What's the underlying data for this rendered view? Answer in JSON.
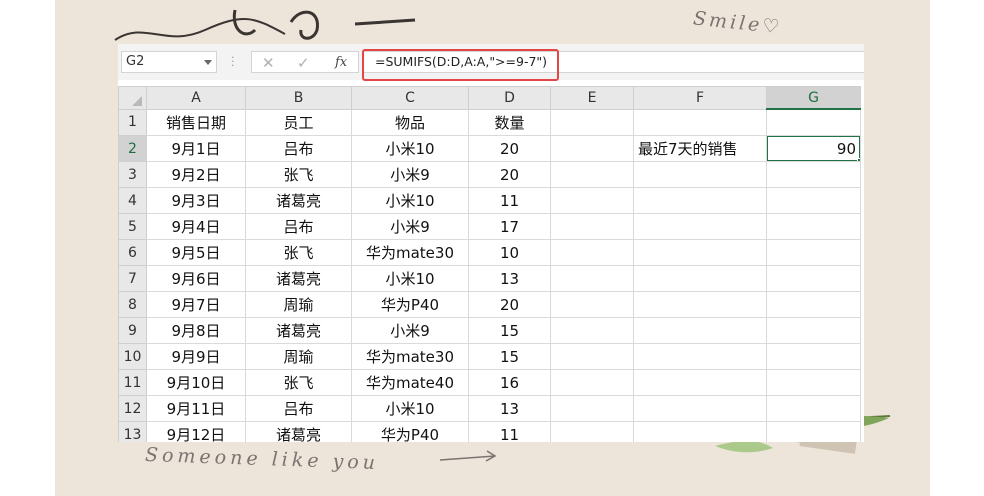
{
  "decor": {
    "smile_text": "Smile♡",
    "bottom_text": "Someone like you"
  },
  "formula_bar": {
    "name_box": "G2",
    "cancel_icon": "✕",
    "enter_icon": "✓",
    "fx_label": "fx",
    "formula": "=SUMIFS(D:D,A:A,\">=9-7\")"
  },
  "columns": [
    "A",
    "B",
    "C",
    "D",
    "E",
    "F",
    "G"
  ],
  "rows": [
    {
      "num": "1",
      "a": "销售日期",
      "b": "员工",
      "c": "物品",
      "d": "数量",
      "e": "",
      "f": "",
      "g": ""
    },
    {
      "num": "2",
      "a": "9月1日",
      "b": "吕布",
      "c": "小米10",
      "d": "20",
      "e": "",
      "f": "最近7天的销售",
      "g": "90"
    },
    {
      "num": "3",
      "a": "9月2日",
      "b": "张飞",
      "c": "小米9",
      "d": "20",
      "e": "",
      "f": "",
      "g": ""
    },
    {
      "num": "4",
      "a": "9月3日",
      "b": "诸葛亮",
      "c": "小米10",
      "d": "11",
      "e": "",
      "f": "",
      "g": ""
    },
    {
      "num": "5",
      "a": "9月4日",
      "b": "吕布",
      "c": "小米9",
      "d": "17",
      "e": "",
      "f": "",
      "g": ""
    },
    {
      "num": "6",
      "a": "9月5日",
      "b": "张飞",
      "c": "华为mate30",
      "d": "10",
      "e": "",
      "f": "",
      "g": ""
    },
    {
      "num": "7",
      "a": "9月6日",
      "b": "诸葛亮",
      "c": "小米10",
      "d": "13",
      "e": "",
      "f": "",
      "g": ""
    },
    {
      "num": "8",
      "a": "9月7日",
      "b": "周瑜",
      "c": "华为P40",
      "d": "20",
      "e": "",
      "f": "",
      "g": ""
    },
    {
      "num": "9",
      "a": "9月8日",
      "b": "诸葛亮",
      "c": "小米9",
      "d": "15",
      "e": "",
      "f": "",
      "g": ""
    },
    {
      "num": "10",
      "a": "9月9日",
      "b": "周瑜",
      "c": "华为mate30",
      "d": "15",
      "e": "",
      "f": "",
      "g": ""
    },
    {
      "num": "11",
      "a": "9月10日",
      "b": "张飞",
      "c": "华为mate40",
      "d": "16",
      "e": "",
      "f": "",
      "g": ""
    },
    {
      "num": "12",
      "a": "9月11日",
      "b": "吕布",
      "c": "小米10",
      "d": "13",
      "e": "",
      "f": "",
      "g": ""
    },
    {
      "num": "13",
      "a": "9月12日",
      "b": "诸葛亮",
      "c": "华为P40",
      "d": "11",
      "e": "",
      "f": "",
      "g": ""
    }
  ],
  "selection": {
    "column": "G",
    "row": "2"
  },
  "colors": {
    "accent": "#217346",
    "highlight": "#e64545",
    "paper": "#ede4da"
  }
}
